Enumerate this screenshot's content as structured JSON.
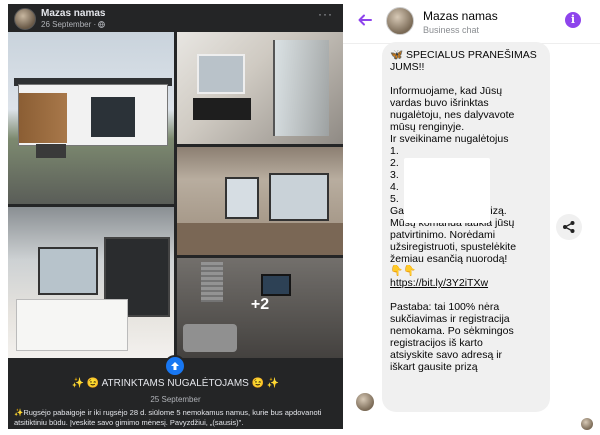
{
  "post": {
    "author": "Mazas namas",
    "date": "26 September · ",
    "more": "···",
    "more_photos": "+2",
    "caption": "✨ 😉 ATRINKTAMS NUGALĖTOJAMS 😉 ✨",
    "caption_date": "25 September",
    "body": "✨Rugsėjo pabaigoje ir iki rugsėjo 28 d. siūlome 5 nemokamus namus, kurie bus apdovanoti atsitiktiniu būdu. Įveskite savo gimimo mėnesį. Pavyzdžiui, „(sausis)\"."
  },
  "chat": {
    "name": "Mazas namas",
    "subtitle": "Business chat",
    "info_label": "i",
    "message_lines": [
      "🦋 SPECIALUS PRANEŠIMAS",
      "JUMS!!",
      "",
      "Informuojame, kad Jūsų",
      "vardas buvo išrinktas",
      "nugalėtoju, nes dalyvavote",
      "mūsų renginyje.",
      "Ir sveikiname nugalėtojus",
      "1.",
      "2.",
      "3.",
      "4.",
      "5.",
      "Galite atsiimti savo prizą.",
      "Mūsų komanda laukia jūsų",
      "patvirtinimo. Norėdami",
      "užsiregistruoti, spustelėkite",
      "žemiau esančią nuorodą!",
      "👇👇",
      "https://bit.ly/3Y2iTXw",
      "",
      "Pastaba: tai 100% nėra",
      "sukčiavimas ir registracija",
      "nemokama. Po sėkmingos",
      "registracijos iš karto",
      "atsiyskite savo adresą ir",
      "iškart gausite prizą"
    ]
  },
  "colors": {
    "fb_bg": "#242526",
    "accent_purple": "#8e44ec",
    "bubble_bg": "#f0f0f0",
    "fb_blue": "#1877f2"
  },
  "icons": [
    "more-icon",
    "globe-icon",
    "share-icon",
    "back-arrow-icon",
    "info-icon"
  ]
}
